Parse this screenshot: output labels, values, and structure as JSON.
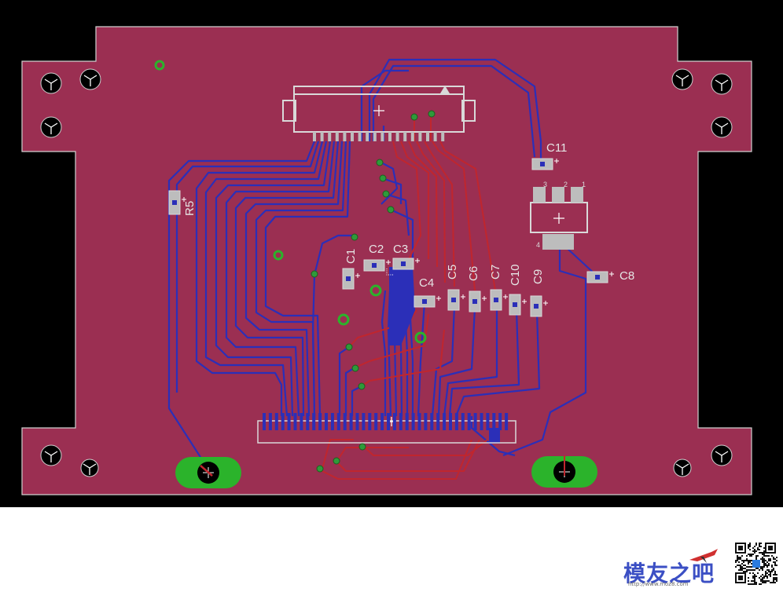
{
  "view": {
    "name": "PCB board layout",
    "colors": {
      "background": "#000000",
      "board": "#9b2f52",
      "board_outline": "#d0d0d0",
      "bottom_trace": "#2b2fb8",
      "top_trace": "#c0262e",
      "silkscreen": "#d9d9d9",
      "via": "#2f9a3a",
      "pad_green": "#2bb32b"
    }
  },
  "silkscreen_labels": {
    "c1": "C1",
    "c2": "C2",
    "c3": "C3",
    "c4": "C4",
    "c5": "C5",
    "c6": "C6",
    "c7": "C7",
    "c8": "C8",
    "c9": "C9",
    "c10": "C10",
    "c11": "C11",
    "r5": "R5",
    "reg_pin1": "1",
    "reg_pin2": "2",
    "reg_pin3": "3",
    "reg_pin4": "4"
  },
  "watermark": {
    "text": "模友之吧",
    "url": "http://www.moz8.com",
    "text_color": "#3b4fc4"
  }
}
